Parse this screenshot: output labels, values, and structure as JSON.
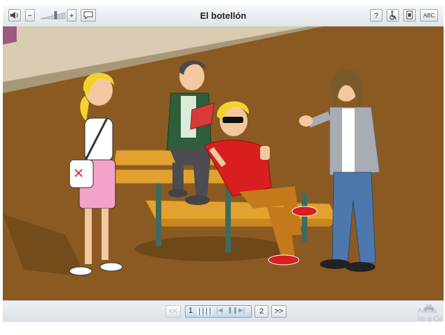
{
  "window": {
    "title": "El botellón"
  },
  "toolbar": {
    "volume_icon": "speaker-icon",
    "minus_label": "−",
    "plus_label": "+",
    "speech_icon": "speech-bubble-icon",
    "help_label": "?",
    "accessibility_icon": "wheelchair-icon",
    "document_icon": "document-icon",
    "abc_label": "ABC"
  },
  "navigation": {
    "prev_label": "<<",
    "current_page": "1",
    "next_page_label": "2",
    "next_label": ">>"
  },
  "watermark": {
    "line1": "Activa",
    "line2": "Ve a Co"
  },
  "colors": {
    "ground": "#8a5a22",
    "wall": "#d9cbb1",
    "bench": "#e3a22f",
    "bench_frame": "#3f6b5f"
  }
}
